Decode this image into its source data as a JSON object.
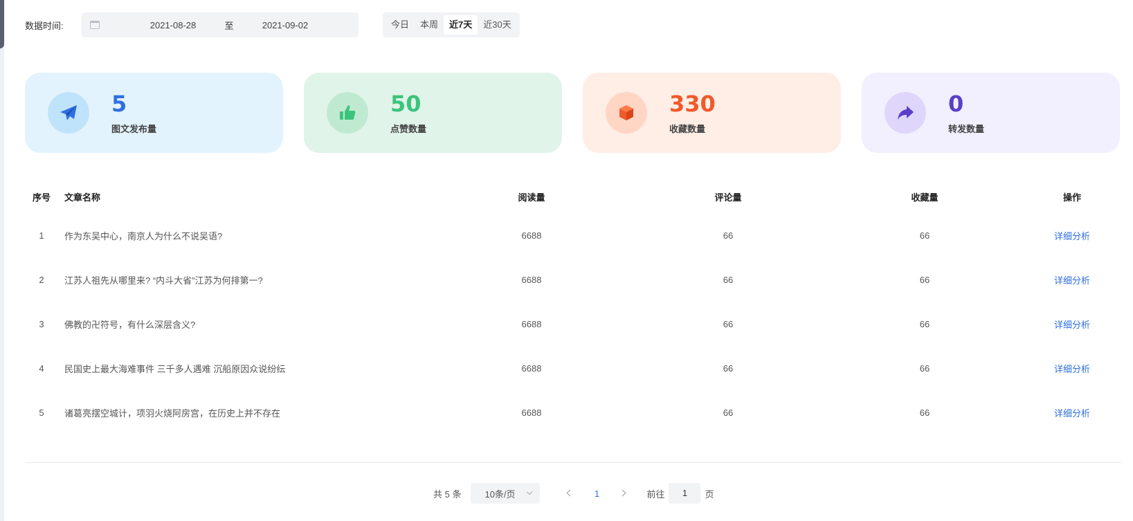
{
  "filter": {
    "label": "数据时间:",
    "start_date": "2021-08-28",
    "separator": "至",
    "end_date": "2021-09-02",
    "quick_ranges": [
      "今日",
      "本周",
      "近7天",
      "近30天"
    ],
    "active_range": "近7天"
  },
  "stats": [
    {
      "value": "5",
      "label": "图文发布量",
      "icon": "paper-plane-icon",
      "color": "#2f6fe0",
      "bg": "#e3f3fd",
      "circle": "#bfe3fb"
    },
    {
      "value": "50",
      "label": "点赞数量",
      "icon": "thumbs-up-icon",
      "color": "#3cc47c",
      "bg": "#e1f4e9",
      "circle": "#c0e9d2"
    },
    {
      "value": "330",
      "label": "收藏数量",
      "icon": "box-icon",
      "color": "#f05a2a",
      "bg": "#ffeee6",
      "circle": "#ffd6c4"
    },
    {
      "value": "0",
      "label": "转发数量",
      "icon": "share-arrow-icon",
      "color": "#5a3fc8",
      "bg": "#f2effe",
      "circle": "#ded7fb"
    }
  ],
  "table": {
    "headers": {
      "idx": "序号",
      "title": "文章名称",
      "read": "阅读量",
      "comment": "评论量",
      "fav": "收藏量",
      "op": "操作"
    },
    "rows": [
      {
        "idx": "1",
        "title": "作为东吴中心，南京人为什么不说吴语?",
        "read": "6688",
        "comment": "66",
        "fav": "66",
        "op": "详细分析"
      },
      {
        "idx": "2",
        "title": "江苏人祖先从哪里来? “内斗大省”江苏为何排第一?",
        "read": "6688",
        "comment": "66",
        "fav": "66",
        "op": "详细分析"
      },
      {
        "idx": "3",
        "title": "佛教的卍符号，有什么深层含义?",
        "read": "6688",
        "comment": "66",
        "fav": "66",
        "op": "详细分析"
      },
      {
        "idx": "4",
        "title": "民国史上最大海难事件 三千多人遇难 沉船原因众说纷纭",
        "read": "6688",
        "comment": "66",
        "fav": "66",
        "op": "详细分析"
      },
      {
        "idx": "5",
        "title": "诸葛亮摆空城计，项羽火烧阿房宫，在历史上并不存在",
        "read": "6688",
        "comment": "66",
        "fav": "66",
        "op": "详细分析"
      }
    ]
  },
  "pagination": {
    "total": "共 5 条",
    "page_size": "10条/页",
    "current_page": "1",
    "goto_label": "前往",
    "goto_value": "1",
    "page_unit": "页"
  }
}
